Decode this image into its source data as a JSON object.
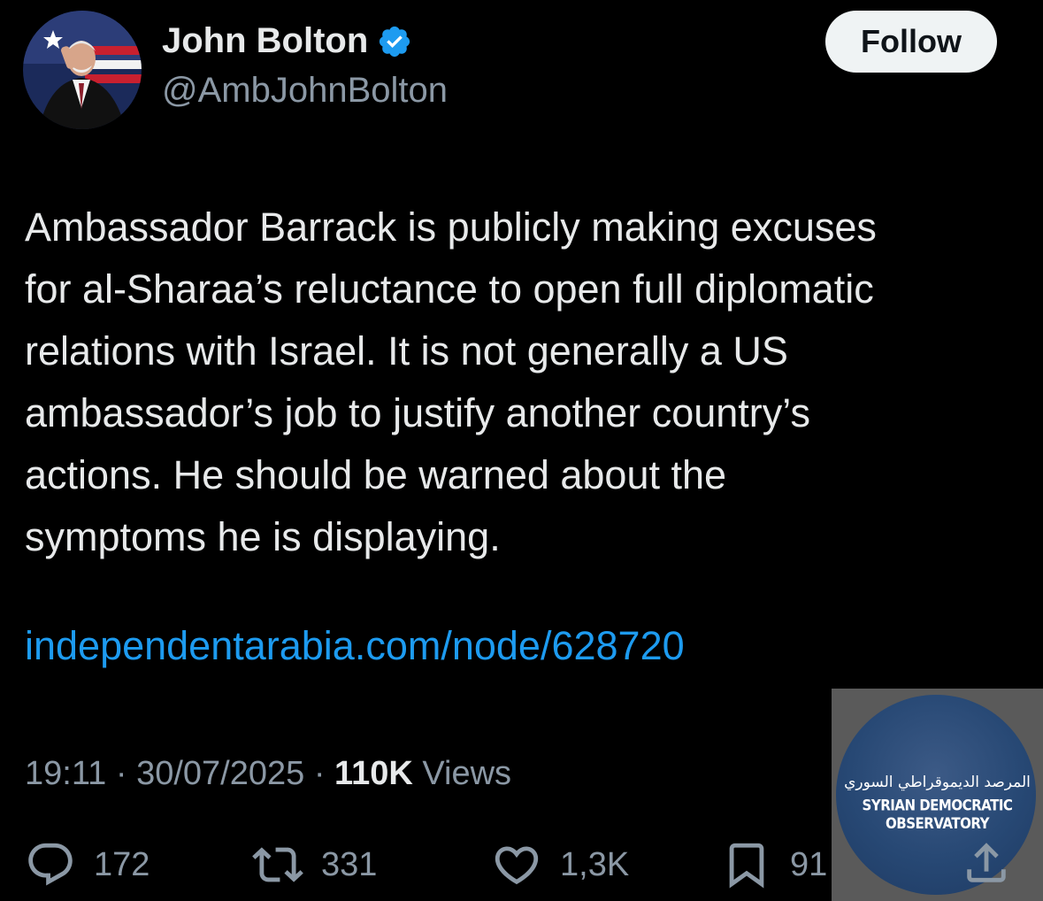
{
  "author": {
    "name": "John Bolton",
    "handle": "@AmbJohnBolton",
    "verified_color": "#1d9bf0"
  },
  "follow_label": "Follow",
  "tweet": {
    "lines": [
      "Ambassador Barrack is publicly making excuses",
      "for al-Sharaa’s reluctance to open full diplomatic",
      "relations with Israel. It is not generally a US",
      "ambassador’s job to justify another country’s",
      "actions. He should be warned about the",
      "symptoms he is displaying."
    ],
    "link": "independentarabia.com/node/628720"
  },
  "meta": {
    "time": "19:11",
    "date": "30/07/2025",
    "views_count": "110K",
    "views_label": "Views"
  },
  "actions": {
    "replies": "172",
    "reposts": "331",
    "likes": "1,3K",
    "bookmarks": "91"
  },
  "watermark": {
    "arabic": "المرصد الديموقراطي السوري",
    "english": "SYRIAN DEMOCRATIC OBSERVATORY"
  },
  "colors": {
    "background": "#000000",
    "text": "#e7e9ea",
    "secondary": "#8b98a5",
    "link": "#1d9bf0"
  }
}
